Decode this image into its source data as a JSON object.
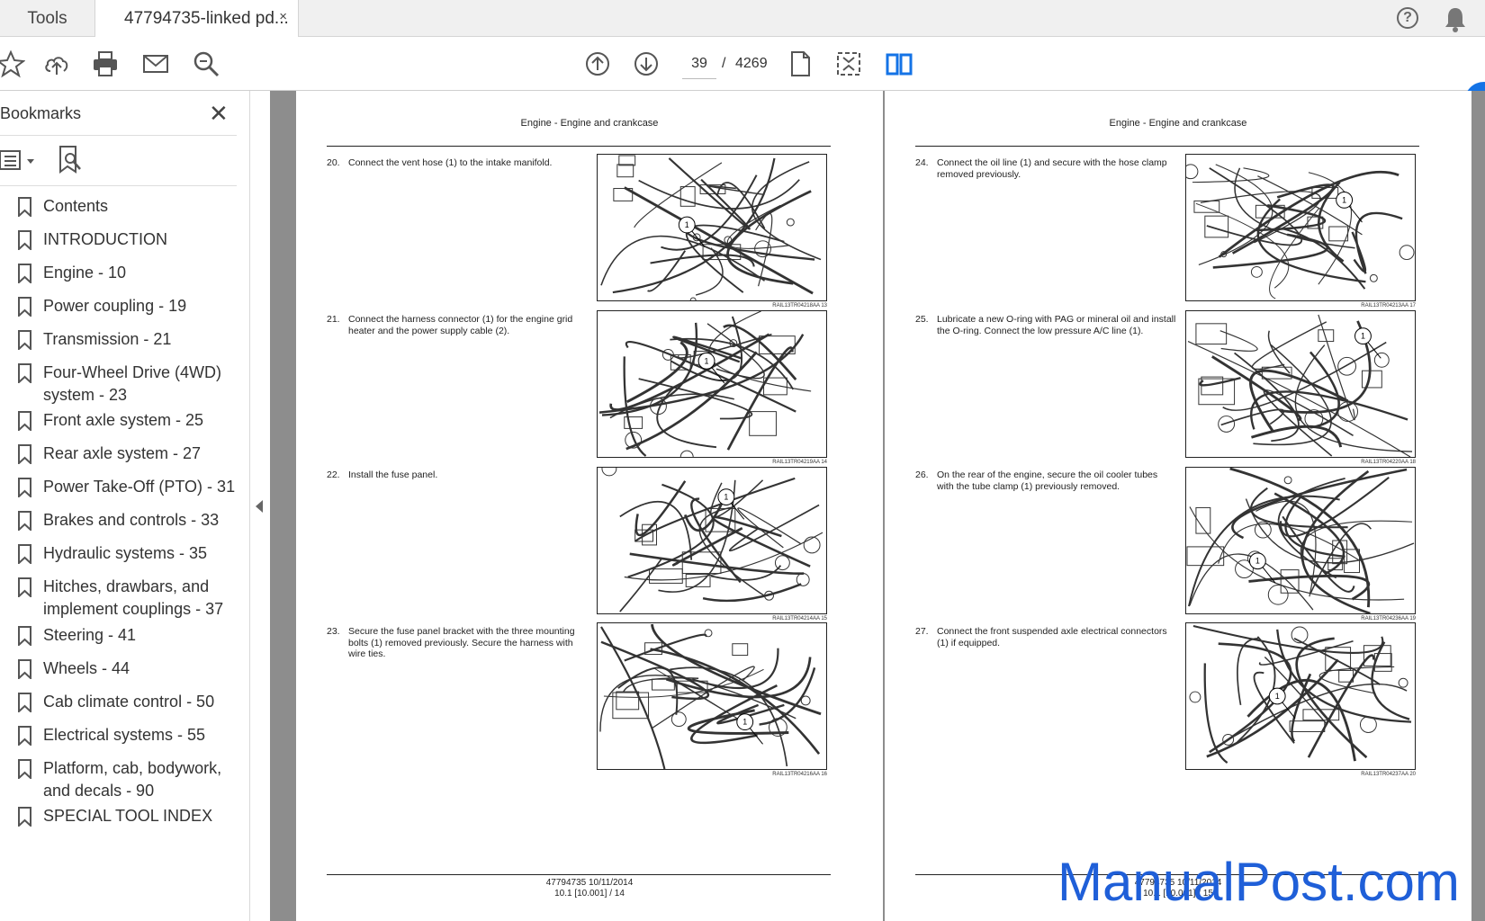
{
  "tabs": {
    "tools": "Tools",
    "document": "47794735-linked pd...",
    "close_icon": "×"
  },
  "header_icons": {
    "help": "?"
  },
  "toolbar": {
    "current_page": "39",
    "separator": "/",
    "total_pages": "4269"
  },
  "bookmarks": {
    "title": "Bookmarks",
    "close": "✕",
    "items": [
      "Contents",
      "INTRODUCTION",
      "Engine - 10",
      "Power coupling - 19",
      "Transmission - 21",
      "Four-Wheel Drive (4WD) system - 23",
      "Front axle system - 25",
      "Rear axle system - 27",
      "Power Take-Off (PTO) - 31",
      "Brakes and controls - 33",
      "Hydraulic systems - 35",
      "Hitches, drawbars, and implement couplings - 37",
      "Steering - 41",
      "Wheels - 44",
      "Cab climate control - 50",
      "Electrical systems - 55",
      "Platform, cab, bodywork, and decals - 90",
      "SPECIAL TOOL INDEX"
    ]
  },
  "pages": {
    "left": {
      "header": "Engine - Engine and crankcase",
      "steps": [
        {
          "num": "20.",
          "text": "Connect the vent hose (1) to the intake manifold.",
          "caption": "RAIL13TR04218AA    13"
        },
        {
          "num": "21.",
          "text": "Connect the harness connector (1) for the engine grid heater and the power supply cable (2).",
          "caption": "RAIL13TR04219AA    14"
        },
        {
          "num": "22.",
          "text": "Install the fuse panel.",
          "caption": "RAIL13TR04214AA    15"
        },
        {
          "num": "23.",
          "text": "Secure the fuse panel bracket with the three mounting bolts (1) removed previously. Secure the harness with wire ties.",
          "caption": "RAIL13TR04216AA    16"
        }
      ],
      "footer_line1": "47794735 10/11/2014",
      "footer_line2": "10.1 [10.001] / 14"
    },
    "right": {
      "header": "Engine - Engine and crankcase",
      "steps": [
        {
          "num": "24.",
          "text": "Connect the oil line (1) and secure with the hose clamp removed previously.",
          "caption": "RAIL13TR04213AA    17"
        },
        {
          "num": "25.",
          "text": "Lubricate a new O-ring with PAG or mineral oil and install the O-ring. Connect the low pressure A/C line (1).",
          "caption": "RAIL13TR04220AA    18"
        },
        {
          "num": "26.",
          "text": "On the rear of the engine, secure the oil cooler tubes with the tube clamp (1) previously removed.",
          "caption": "RAIL13TR04236AA    19"
        },
        {
          "num": "27.",
          "text": "Connect the front suspended axle electrical connectors (1) if equipped.",
          "caption": "RAIL13TR04237AA    20"
        }
      ],
      "footer_line1": "47794735 10/11/2014",
      "footer_line2": "10.1 [10.001] / 15"
    }
  },
  "watermark": "ManualPost.com"
}
